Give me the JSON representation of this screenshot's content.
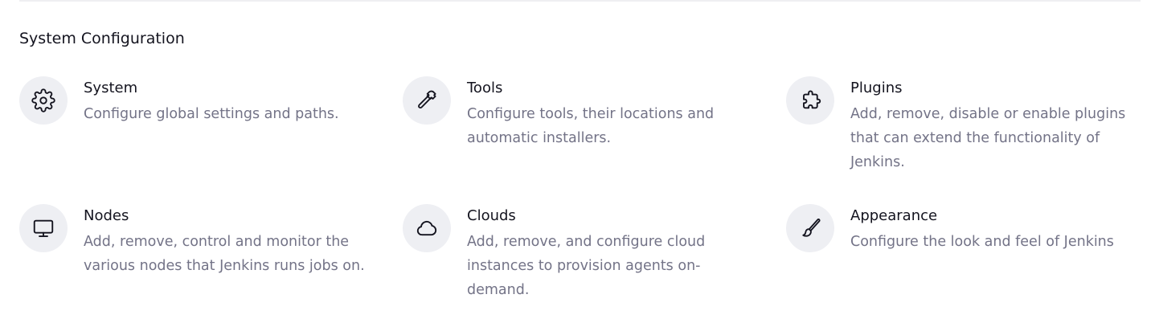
{
  "section": {
    "title": "System Configuration"
  },
  "items": [
    {
      "title": "System",
      "description": "Configure global settings and paths.",
      "icon": "gear-icon"
    },
    {
      "title": "Tools",
      "description": "Configure tools, their locations and automatic installers.",
      "icon": "hammer-icon"
    },
    {
      "title": "Plugins",
      "description": "Add, remove, disable or enable plugins that can extend the functionality of Jenkins.",
      "icon": "puzzle-icon"
    },
    {
      "title": "Nodes",
      "description": "Add, remove, control and monitor the various nodes that Jenkins runs jobs on.",
      "icon": "monitor-icon"
    },
    {
      "title": "Clouds",
      "description": "Add, remove, and configure cloud instances to provision agents on-demand.",
      "icon": "cloud-icon"
    },
    {
      "title": "Appearance",
      "description": "Configure the look and feel of Jenkins",
      "icon": "brush-icon"
    }
  ],
  "colors": {
    "title_text": "#14141f",
    "description_text": "#737387",
    "icon_background": "#eeeff3"
  }
}
